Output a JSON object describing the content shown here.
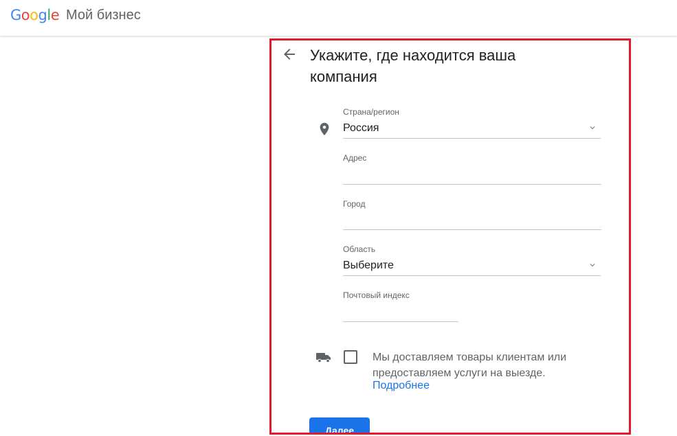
{
  "header": {
    "logo_letters": [
      {
        "char": "G",
        "color": "#4285F4"
      },
      {
        "char": "o",
        "color": "#EA4335"
      },
      {
        "char": "o",
        "color": "#FBBC05"
      },
      {
        "char": "g",
        "color": "#4285F4"
      },
      {
        "char": "l",
        "color": "#34A853"
      },
      {
        "char": "e",
        "color": "#EA4335"
      }
    ],
    "product_name": "Мой бизнес"
  },
  "form": {
    "title": "Укажите, где находится ваша компания",
    "country": {
      "label": "Страна/регион",
      "value": "Россия"
    },
    "address": {
      "label": "Адрес",
      "value": ""
    },
    "city": {
      "label": "Город",
      "value": ""
    },
    "region": {
      "label": "Область",
      "value": "Выберите"
    },
    "postal": {
      "label": "Почтовый индекс",
      "value": ""
    },
    "delivery": {
      "text": "Мы доставляем товары клиентам или предоставляем услуги на выезде.",
      "checked": false,
      "link": "Подробнее"
    },
    "next_button": "Далее"
  },
  "colors": {
    "accent": "#1a73e8",
    "highlight_border": "#e21b2b"
  },
  "icons": [
    "back-arrow-icon",
    "location-pin-icon",
    "chevron-down-icon",
    "truck-icon"
  ]
}
